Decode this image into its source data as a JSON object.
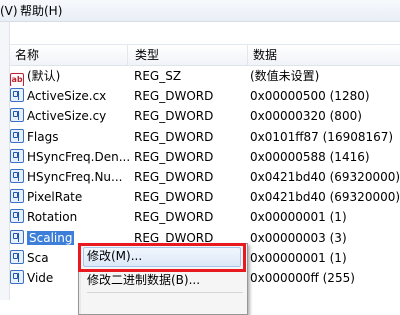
{
  "menubar": {
    "partial_item": "(V)",
    "help": "帮助(H)"
  },
  "columns": {
    "name": "名称",
    "type": "类型",
    "data": "数据"
  },
  "rows": [
    {
      "icon": "string-value-icon",
      "name": "(默认)",
      "type": "REG_SZ",
      "data": "(数值未设置)"
    },
    {
      "icon": "binary-value-icon",
      "name": "ActiveSize.cx",
      "type": "REG_DWORD",
      "data": "0x00000500 (1280)"
    },
    {
      "icon": "binary-value-icon",
      "name": "ActiveSize.cy",
      "type": "REG_DWORD",
      "data": "0x00000320 (800)"
    },
    {
      "icon": "binary-value-icon",
      "name": "Flags",
      "type": "REG_DWORD",
      "data": "0x0101ff87 (16908167)"
    },
    {
      "icon": "binary-value-icon",
      "name": "HSyncFreq.Den...",
      "type": "REG_DWORD",
      "data": "0x00000588 (1416)"
    },
    {
      "icon": "binary-value-icon",
      "name": "HSyncFreq.Nu...",
      "type": "REG_DWORD",
      "data": "0x0421bd40 (69320000)"
    },
    {
      "icon": "binary-value-icon",
      "name": "PixelRate",
      "type": "REG_DWORD",
      "data": "0x0421bd40 (69320000)"
    },
    {
      "icon": "binary-value-icon",
      "name": "Rotation",
      "type": "REG_DWORD",
      "data": "0x00000001 (1)"
    },
    {
      "icon": "binary-value-icon",
      "name": "Scaling",
      "type": "REG_DWORD",
      "data": "0x00000003 (3)",
      "selected": true
    },
    {
      "icon": "binary-value-icon",
      "name": "Sca",
      "type": "",
      "data": "0x00000001 (1)"
    },
    {
      "icon": "binary-value-icon",
      "name": "Vide",
      "type": "",
      "data": "0x000000ff (255)"
    }
  ],
  "context_menu": {
    "modify": "修改(M)...",
    "modify_binary": "修改二进制数据(B)..."
  },
  "colors": {
    "highlight_box": "#e8191f",
    "selection": "#3d7fd8"
  }
}
